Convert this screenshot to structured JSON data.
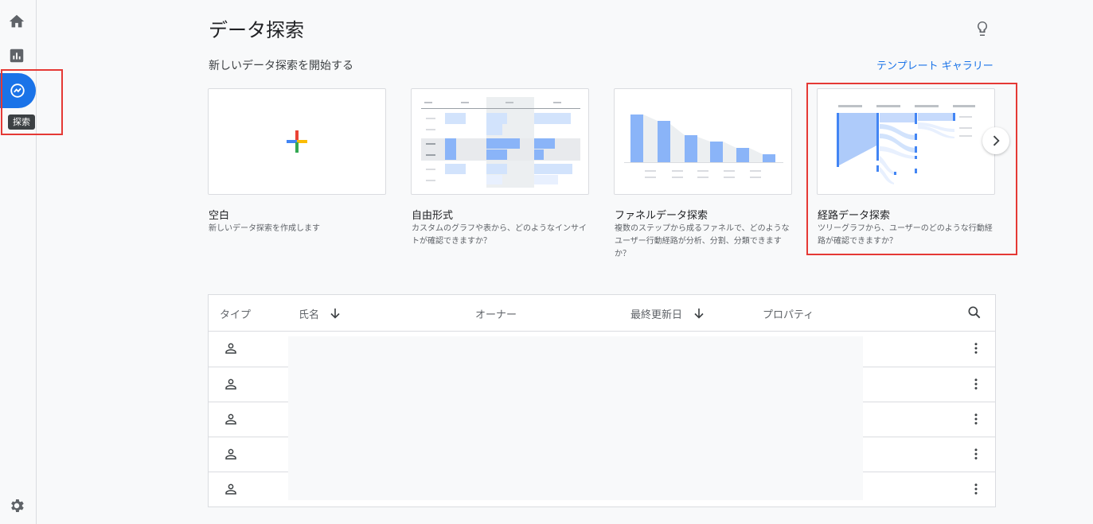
{
  "nav": {
    "tooltip": "探索"
  },
  "header": {
    "title": "データ探索",
    "section_title": "新しいデータ探索を開始する",
    "gallery_link": "テンプレート ギャラリー"
  },
  "cards": [
    {
      "title": "空白",
      "desc": "新しいデータ探索を作成します"
    },
    {
      "title": "自由形式",
      "desc": "カスタムのグラフや表から、どのようなインサイトが確認できますか？"
    },
    {
      "title": "ファネルデータ探索",
      "desc": "複数のステップから成るファネルで、どのようなユーザー行動経路が分析、分割、分類できますか？"
    },
    {
      "title": "経路データ探索",
      "desc": "ツリーグラフから、ユーザーのどのような行動経路が確認できますか？"
    }
  ],
  "table": {
    "columns": {
      "type": "タイプ",
      "name": "氏名",
      "owner": "オーナー",
      "updated": "最終更新日",
      "property": "プロパティ"
    },
    "row_count": 5
  },
  "colors": {
    "accent": "#1a73e8",
    "highlight": "#e53935"
  }
}
